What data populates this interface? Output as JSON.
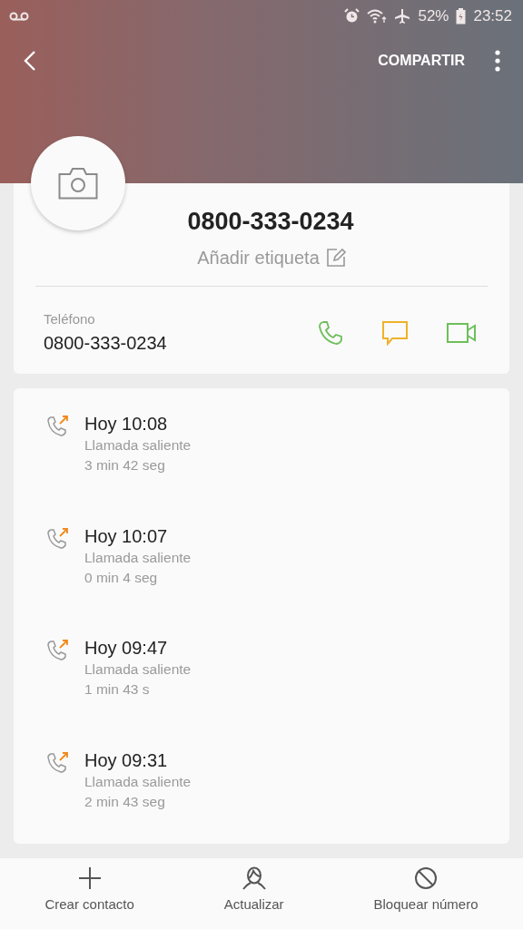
{
  "status_bar": {
    "battery": "52%",
    "time": "23:52"
  },
  "header": {
    "share": "COMPARTIR"
  },
  "contact": {
    "name": "0800-333-0234",
    "label_action": "Añadir etiqueta",
    "phone_label": "Teléfono",
    "phone_number": "0800-333-0234"
  },
  "calls": [
    {
      "time": "Hoy 10:08",
      "type": "Llamada saliente",
      "duration": "3 min 42 seg"
    },
    {
      "time": "Hoy 10:07",
      "type": "Llamada saliente",
      "duration": "0 min 4 seg"
    },
    {
      "time": "Hoy 09:47",
      "type": "Llamada saliente",
      "duration": "1 min 43 s"
    },
    {
      "time": "Hoy 09:31",
      "type": "Llamada saliente",
      "duration": "2 min 43 seg"
    }
  ],
  "bottom_actions": [
    {
      "kind": "add",
      "label": "Crear contacto"
    },
    {
      "kind": "update",
      "label": "Actualizar"
    },
    {
      "kind": "block",
      "label": "Bloquear número"
    }
  ]
}
